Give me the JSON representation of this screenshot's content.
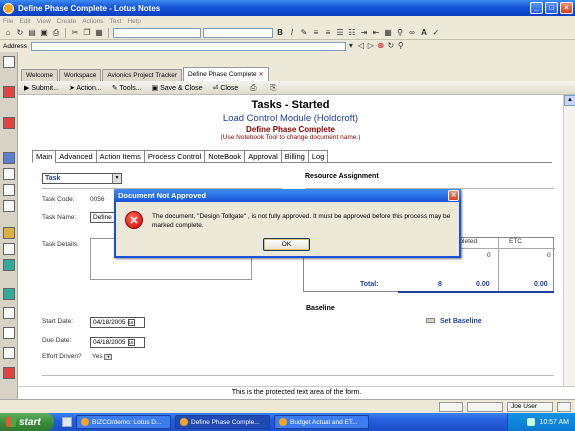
{
  "window": {
    "title": "Define Phase Complete - Lotus Notes",
    "buttons": [
      "_",
      "□",
      "×"
    ]
  },
  "menu": [
    "File",
    "Edit",
    "View",
    "Create",
    "Actions",
    "Text",
    "Help"
  ],
  "address": {
    "label": "Address"
  },
  "window_tabs": [
    "Welcome",
    "Workspace",
    "Avionics Project Tracker",
    "Define Phase Complete"
  ],
  "actions": {
    "submit": "Submit...",
    "action": "Action...",
    "tools": "Tools...",
    "save_close": "Save & Close",
    "close": "Close"
  },
  "doc": {
    "title": "Tasks - Started",
    "subtitle": "Load Control Module (Holdcroft)",
    "doc_name": "Define Phase Complete",
    "hint": "(Use Notebook Tool to change document name.)"
  },
  "form_tabs": [
    "Main",
    "Advanced",
    "Action Items",
    "Process Control",
    "NoteBook",
    "Approval",
    "Billing",
    "Log"
  ],
  "form": {
    "type_value": "Task",
    "task_code_label": "Task Code:",
    "task_code_value": "0056",
    "task_name_label": "Task Name:",
    "task_name_value": "Define P",
    "task_details_label": "Task Details:",
    "resource_assignment": "Resource Assignment",
    "grid_completed": "mpleted",
    "grid_etc": "ETC",
    "grid_val1": "0",
    "grid_val2": "0",
    "total_label": "Total:",
    "total_1": "8",
    "total_2": "0.00",
    "total_3": "0.00",
    "baseline": "Baseline",
    "set_baseline": "Set Baseline",
    "start_date_label": "Start Date:",
    "start_date": "04/18/2005",
    "due_date_label": "Due Date:",
    "due_date": "04/18/2005",
    "effort_label": "Effort Driven?",
    "effort_value": "Yes"
  },
  "protected_text": "This is the protected text area of the form.",
  "status": {
    "user": "Joe User"
  },
  "dialog": {
    "title": "Document Not Approved",
    "message": "The document, \"Design Tollgate\" , is not fully approved. It must be approved before this process may be marked complete.",
    "ok": "OK"
  },
  "taskbar": {
    "start": "start",
    "items": [
      "BIZCO/demo: Lotus D...",
      "Define Phase Comple...",
      "Budget Actual and ET..."
    ],
    "clock": "10:57 AM"
  }
}
